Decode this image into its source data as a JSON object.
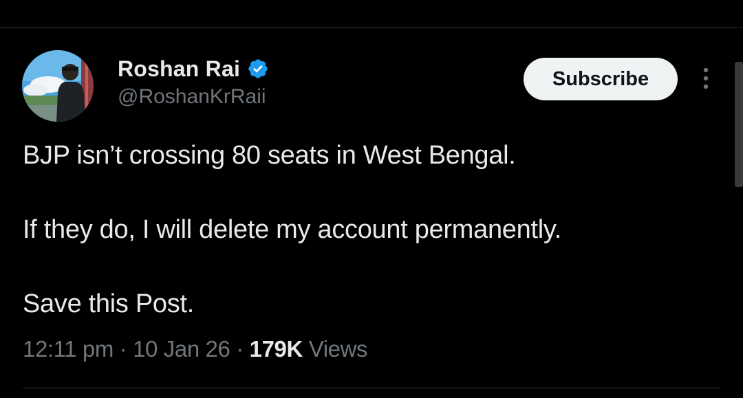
{
  "author": {
    "display_name": "Roshan Rai",
    "handle": "@RoshanKrRaii",
    "verified_icon": "verified-badge-icon",
    "verified_color": "#1d9bf0"
  },
  "actions": {
    "subscribe_label": "Subscribe",
    "more_icon": "more-vertical-icon"
  },
  "tweet": {
    "lines": [
      "BJP isn’t crossing 80 seats in West Bengal.",
      "If they do, I will delete my account permanently.",
      "Save this Post."
    ]
  },
  "meta": {
    "time": "12:11 pm",
    "separator": "·",
    "date": "10 Jan 26",
    "views_count": "179K",
    "views_label": "Views"
  },
  "colors": {
    "background": "#000000",
    "text_primary": "#e7e9ea",
    "text_secondary": "#71767b",
    "button_bg": "#eff3f4",
    "divider": "#2f3336"
  }
}
